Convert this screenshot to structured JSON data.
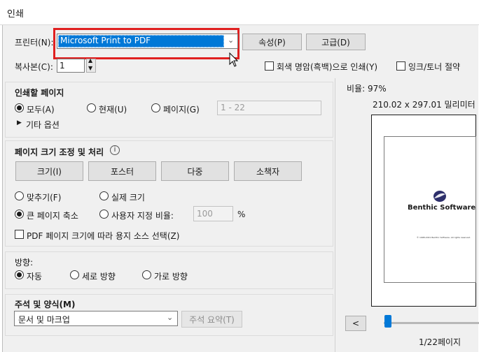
{
  "window": {
    "title": "인쇄"
  },
  "printer": {
    "label": "프린터(N):",
    "selected": "Microsoft Print to PDF",
    "properties_button": "속성(P)",
    "advanced_button": "고급(D)"
  },
  "copies": {
    "label": "복사본(C):",
    "value": "1",
    "grayscale_label": "회색 명암(흑백)으로 인쇄(Y)",
    "ink_save_label": "잉크/토너 절약"
  },
  "pages_to_print": {
    "title": "인쇄할 페이지",
    "all_label": "모두(A)",
    "current_label": "현재(U)",
    "pages_label": "페이지(G)",
    "pages_value": "1 - 22",
    "more_options_label": "기타 옵션"
  },
  "page_sizing": {
    "title": "페이지 크기 조정 및 처리",
    "size_button": "크기(I)",
    "poster_button": "포스터",
    "multiple_button": "다중",
    "booklet_button": "소책자",
    "fit_label": "맞추기(F)",
    "actual_size_label": "실제 크기",
    "shrink_label": "큰 페이지 축소",
    "custom_scale_label": "사용자 지정 비율:",
    "custom_scale_value": "100",
    "percent_symbol": "%",
    "pdf_source_label": "PDF 페이지 크기에 따라 용지 소스 선택(Z)"
  },
  "orientation": {
    "label": "방향:",
    "auto_label": "자동",
    "portrait_label": "세로 방향",
    "landscape_label": "가로 방향"
  },
  "comments": {
    "title": "주석 및 양식(M)",
    "selected": "문서 및 마크업",
    "summarize_button": "주석 요약(T)"
  },
  "preview": {
    "scale_text": "비율: 97%",
    "dimensions_text": "210.02 x 297.01 밀리미터",
    "brand_text": "Benthic Software",
    "copyright_text": "© 1998-2021 Benthic Software. All rights reserved.",
    "prev_button": "<",
    "page_indicator": "1/22페이지"
  },
  "colors": {
    "highlight": "#e02020",
    "selection": "#0078d7",
    "dialog_bg": "#f0f0f0"
  }
}
